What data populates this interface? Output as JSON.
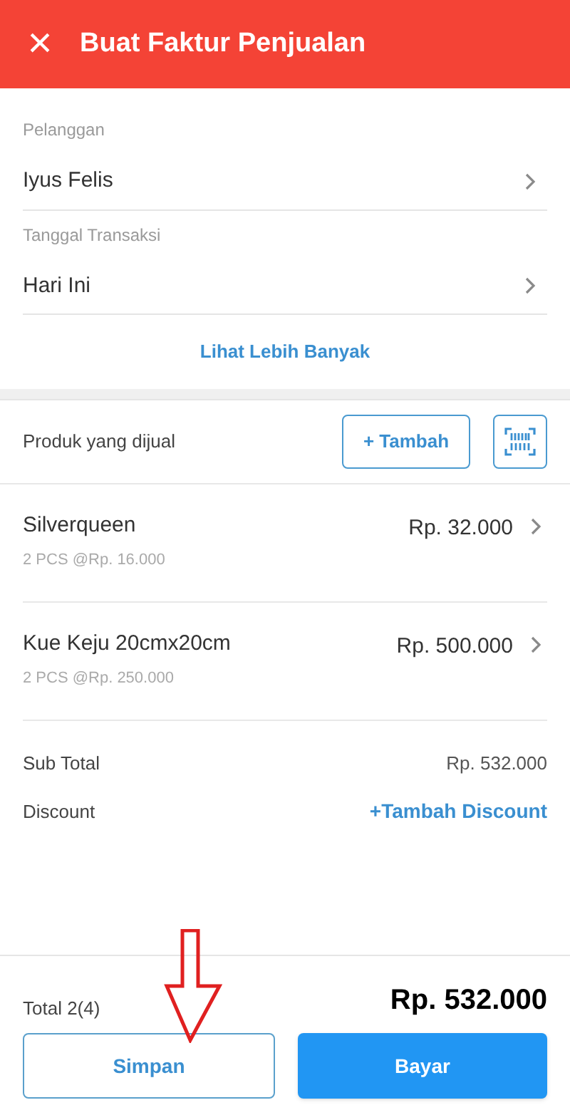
{
  "header": {
    "close": "×",
    "title": "Buat Faktur Penjualan"
  },
  "fields": [
    {
      "label": "Pelanggan",
      "value": "Iyus Felis"
    },
    {
      "label": "Tanggal Transaksi",
      "value": "Hari Ini"
    }
  ],
  "more_link": "Lihat Lebih Banyak",
  "products": {
    "title": "Produk yang dijual",
    "add_button": "+ Tambah",
    "items": [
      {
        "name": "Silverqueen",
        "detail": "2 PCS @Rp. 16.000",
        "price": "Rp. 32.000"
      },
      {
        "name": "Kue Keju 20cmx20cm",
        "detail": "2 PCS @Rp. 250.000",
        "price": "Rp. 500.000"
      }
    ]
  },
  "summary": {
    "subtotal_label": "Sub Total",
    "subtotal": "Rp. 532.000",
    "discount_label": "Discount",
    "discount_link": "+Tambah Discount"
  },
  "footer": {
    "total_label": "Total 2(4)",
    "total": "Rp. 532.000",
    "buttons": [
      {
        "label": "Simpan",
        "kind": "outline"
      },
      {
        "label": "Bayar",
        "kind": "primary"
      }
    ]
  }
}
